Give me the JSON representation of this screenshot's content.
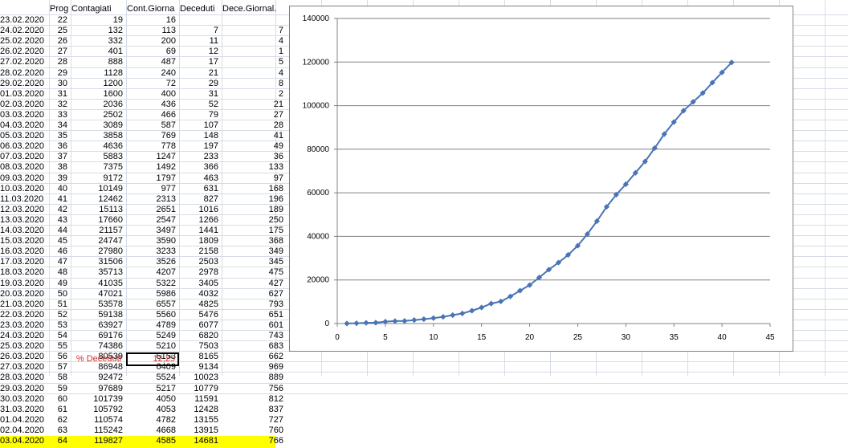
{
  "sheet": {
    "headers": {
      "prog": "Prog",
      "contagiati": "Contagiati",
      "cont_giorna": "Cont.Giorna",
      "deceduti": "Deceduti",
      "dece_giornal": "Dece.Giornal."
    },
    "rows": [
      {
        "date": "23.02.2020",
        "prog": "22",
        "cont": "19",
        "cg": "16",
        "dec": "",
        "dg": ""
      },
      {
        "date": "24.02.2020",
        "prog": "25",
        "cont": "132",
        "cg": "113",
        "dec": "7",
        "dg": "7"
      },
      {
        "date": "25.02.2020",
        "prog": "26",
        "cont": "332",
        "cg": "200",
        "dec": "11",
        "dg": "4"
      },
      {
        "date": "26.02.2020",
        "prog": "27",
        "cont": "401",
        "cg": "69",
        "dec": "12",
        "dg": "1"
      },
      {
        "date": "27.02.2020",
        "prog": "28",
        "cont": "888",
        "cg": "487",
        "dec": "17",
        "dg": "5"
      },
      {
        "date": "28.02.2020",
        "prog": "29",
        "cont": "1128",
        "cg": "240",
        "dec": "21",
        "dg": "4"
      },
      {
        "date": "29.02.2020",
        "prog": "30",
        "cont": "1200",
        "cg": "72",
        "dec": "29",
        "dg": "8"
      },
      {
        "date": "01.03.2020",
        "prog": "31",
        "cont": "1600",
        "cg": "400",
        "dec": "31",
        "dg": "2"
      },
      {
        "date": "02.03.2020",
        "prog": "32",
        "cont": "2036",
        "cg": "436",
        "dec": "52",
        "dg": "21"
      },
      {
        "date": "03.03.2020",
        "prog": "33",
        "cont": "2502",
        "cg": "466",
        "dec": "79",
        "dg": "27"
      },
      {
        "date": "04.03.2020",
        "prog": "34",
        "cont": "3089",
        "cg": "587",
        "dec": "107",
        "dg": "28"
      },
      {
        "date": "05.03.2020",
        "prog": "35",
        "cont": "3858",
        "cg": "769",
        "dec": "148",
        "dg": "41"
      },
      {
        "date": "06.03.2020",
        "prog": "36",
        "cont": "4636",
        "cg": "778",
        "dec": "197",
        "dg": "49"
      },
      {
        "date": "07.03.2020",
        "prog": "37",
        "cont": "5883",
        "cg": "1247",
        "dec": "233",
        "dg": "36"
      },
      {
        "date": "08.03.2020",
        "prog": "38",
        "cont": "7375",
        "cg": "1492",
        "dec": "366",
        "dg": "133"
      },
      {
        "date": "09.03.2020",
        "prog": "39",
        "cont": "9172",
        "cg": "1797",
        "dec": "463",
        "dg": "97"
      },
      {
        "date": "10.03.2020",
        "prog": "40",
        "cont": "10149",
        "cg": "977",
        "dec": "631",
        "dg": "168"
      },
      {
        "date": "11.03.2020",
        "prog": "41",
        "cont": "12462",
        "cg": "2313",
        "dec": "827",
        "dg": "196"
      },
      {
        "date": "12.03.2020",
        "prog": "42",
        "cont": "15113",
        "cg": "2651",
        "dec": "1016",
        "dg": "189"
      },
      {
        "date": "13.03.2020",
        "prog": "43",
        "cont": "17660",
        "cg": "2547",
        "dec": "1266",
        "dg": "250"
      },
      {
        "date": "14.03.2020",
        "prog": "44",
        "cont": "21157",
        "cg": "3497",
        "dec": "1441",
        "dg": "175"
      },
      {
        "date": "15.03.2020",
        "prog": "45",
        "cont": "24747",
        "cg": "3590",
        "dec": "1809",
        "dg": "368"
      },
      {
        "date": "16.03.2020",
        "prog": "46",
        "cont": "27980",
        "cg": "3233",
        "dec": "2158",
        "dg": "349"
      },
      {
        "date": "17.03.2020",
        "prog": "47",
        "cont": "31506",
        "cg": "3526",
        "dec": "2503",
        "dg": "345"
      },
      {
        "date": "18.03.2020",
        "prog": "48",
        "cont": "35713",
        "cg": "4207",
        "dec": "2978",
        "dg": "475"
      },
      {
        "date": "19.03.2020",
        "prog": "49",
        "cont": "41035",
        "cg": "5322",
        "dec": "3405",
        "dg": "427"
      },
      {
        "date": "20.03.2020",
        "prog": "50",
        "cont": "47021",
        "cg": "5986",
        "dec": "4032",
        "dg": "627"
      },
      {
        "date": "21.03.2020",
        "prog": "51",
        "cont": "53578",
        "cg": "6557",
        "dec": "4825",
        "dg": "793"
      },
      {
        "date": "22.03.2020",
        "prog": "52",
        "cont": "59138",
        "cg": "5560",
        "dec": "5476",
        "dg": "651"
      },
      {
        "date": "23.03.2020",
        "prog": "53",
        "cont": "63927",
        "cg": "4789",
        "dec": "6077",
        "dg": "601"
      },
      {
        "date": "24.03.2020",
        "prog": "54",
        "cont": "69176",
        "cg": "5249",
        "dec": "6820",
        "dg": "743"
      },
      {
        "date": "25.03.2020",
        "prog": "55",
        "cont": "74386",
        "cg": "5210",
        "dec": "7503",
        "dg": "683"
      },
      {
        "date": "26.03.2020",
        "prog": "56",
        "cont": "80539",
        "cg": "6153",
        "dec": "8165",
        "dg": "662"
      },
      {
        "date": "27.03.2020",
        "prog": "57",
        "cont": "86948",
        "cg": "6409",
        "dec": "9134",
        "dg": "969"
      },
      {
        "date": "28.03.2020",
        "prog": "58",
        "cont": "92472",
        "cg": "5524",
        "dec": "10023",
        "dg": "889"
      },
      {
        "date": "29.03.2020",
        "prog": "59",
        "cont": "97689",
        "cg": "5217",
        "dec": "10779",
        "dg": "756"
      },
      {
        "date": "30.03.2020",
        "prog": "60",
        "cont": "101739",
        "cg": "4050",
        "dec": "11591",
        "dg": "812"
      },
      {
        "date": "31.03.2020",
        "prog": "61",
        "cont": "105792",
        "cg": "4053",
        "dec": "12428",
        "dg": "837"
      },
      {
        "date": "01.04.2020",
        "prog": "62",
        "cont": "110574",
        "cg": "4782",
        "dec": "13155",
        "dg": "727"
      },
      {
        "date": "02.04.2020",
        "prog": "63",
        "cont": "115242",
        "cg": "4668",
        "dec": "13915",
        "dg": "760"
      },
      {
        "date": "03.04.2020",
        "prog": "64",
        "cont": "119827",
        "cg": "4585",
        "dec": "14681",
        "dg": "766"
      }
    ],
    "footer": {
      "label": "% Deceduti",
      "value": "12,25"
    }
  },
  "colors": {
    "highlight": "#ffff00",
    "series": "#4a74b4",
    "footer_text": "#d03030"
  },
  "chart_data": {
    "type": "line",
    "x": [
      1,
      2,
      3,
      4,
      5,
      6,
      7,
      8,
      9,
      10,
      11,
      12,
      13,
      14,
      15,
      16,
      17,
      18,
      19,
      20,
      21,
      22,
      23,
      24,
      25,
      26,
      27,
      28,
      29,
      30,
      31,
      32,
      33,
      34,
      35,
      36,
      37,
      38,
      39,
      40,
      41
    ],
    "series": [
      {
        "values": [
          19,
          132,
          332,
          401,
          888,
          1128,
          1200,
          1600,
          2036,
          2502,
          3089,
          3858,
          4636,
          5883,
          7375,
          9172,
          10149,
          12462,
          15113,
          17660,
          21157,
          24747,
          27980,
          31506,
          35713,
          41035,
          47021,
          53578,
          59138,
          63927,
          69176,
          74386,
          80539,
          86948,
          92472,
          97689,
          101739,
          105792,
          110574,
          115242,
          119827
        ],
        "marker": "diamond"
      }
    ],
    "xlim": [
      0,
      45
    ],
    "ylim": [
      0,
      140000
    ],
    "xticks": [
      0,
      5,
      10,
      15,
      20,
      25,
      30,
      35,
      40,
      45
    ],
    "yticks": [
      0,
      20000,
      40000,
      60000,
      80000,
      100000,
      120000,
      140000
    ],
    "grid": "horizontal",
    "legend": "none"
  }
}
